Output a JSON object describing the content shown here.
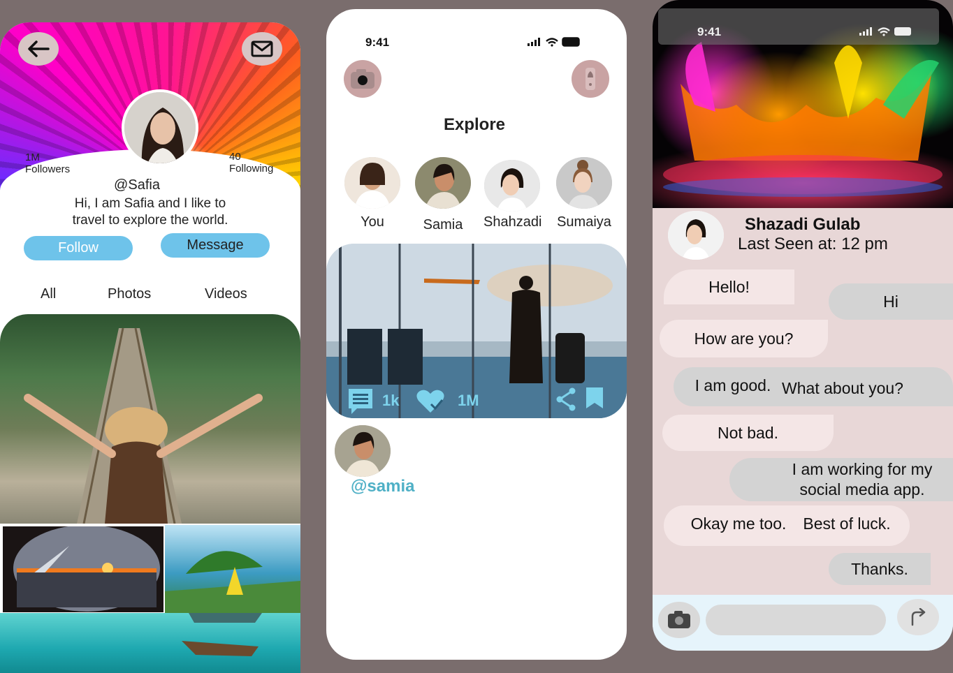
{
  "profile": {
    "followers_count": "1M",
    "followers_label": "Followers",
    "following_count": "40",
    "following_label": "Following",
    "handle": "@Safia",
    "bio_line1": "Hi, I am Safia and I like to",
    "bio_line2": "travel to explore the world.",
    "follow_label": "Follow",
    "message_label": "Message",
    "tabs": [
      "All",
      "Photos",
      "Videos"
    ]
  },
  "explore": {
    "time": "9:41",
    "title": "Explore",
    "stories": [
      {
        "name": "You"
      },
      {
        "name": "Samia"
      },
      {
        "name": "Shahzadi"
      },
      {
        "name": "Sumaiya"
      }
    ],
    "post": {
      "comments": "1k",
      "likes": "1M",
      "author_handle": "@samia"
    }
  },
  "chat": {
    "time": "9:41",
    "contact_name": "Shazadi Gulab",
    "last_seen": "Last Seen at: 12 pm",
    "messages": [
      {
        "dir": "in",
        "text": "Hello!"
      },
      {
        "dir": "out",
        "text": "Hi"
      },
      {
        "dir": "in",
        "text": "How are you?"
      },
      {
        "dir": "in",
        "text": "I am good."
      },
      {
        "dir": "out",
        "text": "What about you?"
      },
      {
        "dir": "in",
        "text": "Not bad."
      },
      {
        "dir": "out",
        "text": "I am working for my social media app."
      },
      {
        "dir": "in",
        "text": "Okay me too."
      },
      {
        "dir": "in",
        "text": "Best of luck."
      },
      {
        "dir": "out",
        "text": "Thanks."
      }
    ]
  },
  "colors": {
    "background": "#7a6d6d",
    "pill_blue": "#6ec3ea",
    "accent_teal": "#4fb0c6",
    "chat_bg": "#e8d7d7",
    "bubble_in": "#f4e6e6",
    "bubble_out": "#d3d3d3"
  }
}
